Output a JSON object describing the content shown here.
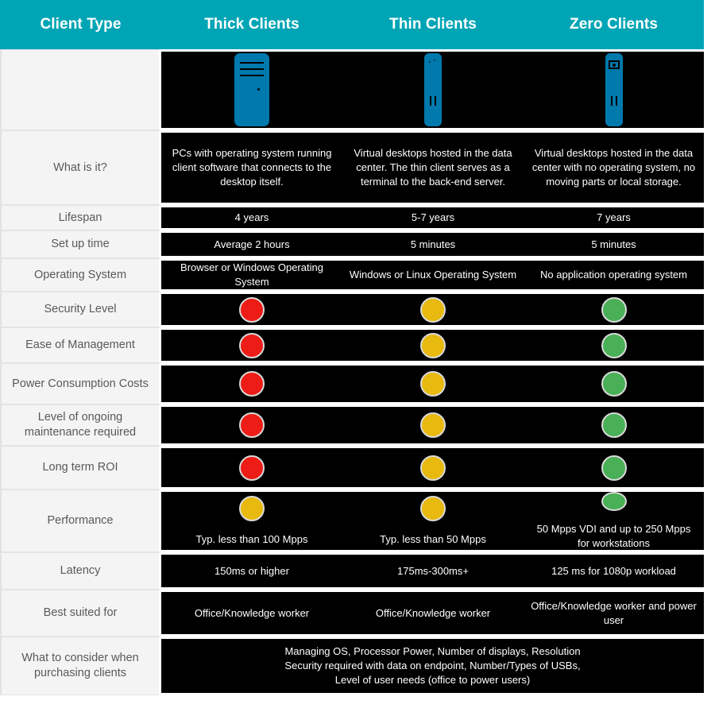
{
  "header": {
    "columns": [
      {
        "label": "Client Type"
      },
      {
        "label": "Thick Clients"
      },
      {
        "label": "Thin Clients"
      },
      {
        "label": "Zero Clients"
      }
    ]
  },
  "colors": {
    "header_teal": "#00a5b5",
    "device_blue": "#0079ad",
    "cell_dark": "#000000",
    "label_bg": "#f4f4f4",
    "label_text": "#58595b",
    "status_red": "#ee1c16",
    "status_yellow": "#e8b90f",
    "status_green": "#49b057"
  },
  "rows": {
    "icons": {
      "label": "",
      "thick_icon": "desktop-tower-icon",
      "thin_icon": "thin-client-device-icon",
      "zero_icon": "zero-client-device-icon"
    },
    "what_is_it": {
      "label": "What is it?",
      "thick": "PCs with operating system running client software that connects to the desktop itself.",
      "thin": "Virtual desktops hosted in the data center. The thin client serves as a terminal to the back-end server.",
      "zero": "Virtual desktops hosted in the data center with no operating system, no moving parts or local storage."
    },
    "lifespan": {
      "label": "Lifespan",
      "thick": "4 years",
      "thin": "5-7 years",
      "zero": "7 years"
    },
    "setup_time": {
      "label": "Set up time",
      "thick": "Average 2 hours",
      "thin": "5 minutes",
      "zero": "5 minutes"
    },
    "operating_system": {
      "label": "Operating System",
      "thick": "Browser or Windows Operating System",
      "thin": "Windows or Linux Operating System",
      "zero": "No application operating system"
    },
    "security_level": {
      "label": "Security Level",
      "thick_status": "red",
      "thin_status": "yellow",
      "zero_status": "green"
    },
    "ease_of_management": {
      "label": "Ease of Management",
      "thick_status": "red",
      "thin_status": "yellow",
      "zero_status": "green"
    },
    "power_consumption": {
      "label": "Power Consumption Costs",
      "thick_status": "red",
      "thin_status": "yellow",
      "zero_status": "green"
    },
    "maintenance": {
      "label": "Level of ongoing maintenance required",
      "thick_status": "red",
      "thin_status": "yellow",
      "zero_status": "green"
    },
    "long_term_roi": {
      "label": "Long term ROI",
      "thick_status": "red",
      "thin_status": "yellow",
      "zero_status": "green"
    },
    "performance": {
      "label": "Performance",
      "thick_status": "yellow",
      "thin_status": "yellow",
      "zero_status": "green",
      "thick": "Typ. less than 100 Mpps",
      "thin": "Typ. less than 50 Mpps",
      "zero": "50 Mpps VDI and up to 250 Mpps for workstations"
    },
    "latency": {
      "label": "Latency",
      "thick": "150ms or higher",
      "thin": "175ms-300ms+",
      "zero": "125 ms for 1080p workload"
    },
    "best_suited_for": {
      "label": "Best suited for",
      "thick": "Office/Knowledge worker",
      "thin": "Office/Knowledge worker",
      "zero": "Office/Knowledge worker and power user"
    },
    "what_to_consider": {
      "label": "What to consider when purchasing clients",
      "line1": "Managing OS, Processor Power, Number of displays, Resolution",
      "line2": "Security required with data on endpoint, Number/Types of USBs,",
      "line3": "Level of user needs (office to power users)"
    }
  }
}
